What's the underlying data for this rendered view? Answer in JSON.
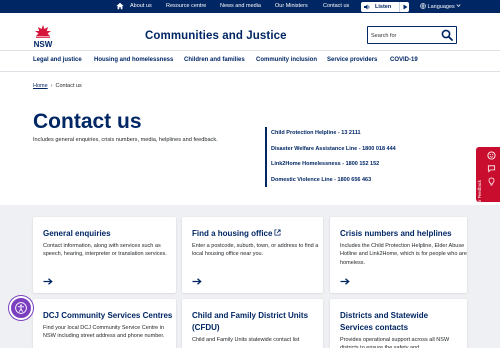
{
  "utility": {
    "links": [
      "About us",
      "Resource centre",
      "News and media",
      "Our Ministers",
      "Contact us"
    ],
    "listen_label": "Listen",
    "languages_label": "Languages"
  },
  "header": {
    "logo_text": "NSW",
    "site_title": "Communities and Justice",
    "search_placeholder": "Search for"
  },
  "mainnav": [
    "Legal and justice",
    "Housing and homelessness",
    "Children and families",
    "Community inclusion",
    "Service providers",
    "COVID-19"
  ],
  "breadcrumb": {
    "home": "Home",
    "current": "Contact us"
  },
  "hero": {
    "title": "Contact us",
    "intro": "Includes general enquiries, crisis numbers, media, helplines and feedback.",
    "quicklinks": [
      "Child Protection Helpline - 13 2111",
      "Disaster Welfare Assistance Line - 1800 018 444",
      "Link2Home Homelessness - 1800 152 152",
      "Domestic Violence Line - 1800 656 463"
    ]
  },
  "feedback_label": "Your Feedback",
  "cards": [
    {
      "title": "General enquiries",
      "desc": "Contact information, along with services such as speech, hearing, interpreter or translation services.",
      "external": false
    },
    {
      "title": "Find a housing office",
      "desc": "Enter a postcode, suburb, town, or address to find a local housing office near you.",
      "external": true
    },
    {
      "title": "Crisis numbers and helplines",
      "desc": "Includes the Child Protection Helpline, Elder Abuse Hotline and Link2Home, which is for people who are homeless.",
      "external": false
    },
    {
      "title": "DCJ Community Services Centres",
      "desc": "Find your local DCJ Community Service Centre in NSW including street address and phone number.",
      "external": false
    },
    {
      "title": "Child and Family District Units (CFDU)",
      "desc": "Child and Family Units statewide contact list",
      "external": false
    },
    {
      "title": "Districts and Statewide Services contacts",
      "desc": "Provides operational support across all NSW districts to ensure the safety and",
      "external": false
    }
  ],
  "colors": {
    "brand_navy": "#002664",
    "nsw_red": "#d7153a",
    "feedback_red": "#c90d2e",
    "card_bg": "#eef0f3",
    "a11y_purple": "#7a3ebf"
  }
}
